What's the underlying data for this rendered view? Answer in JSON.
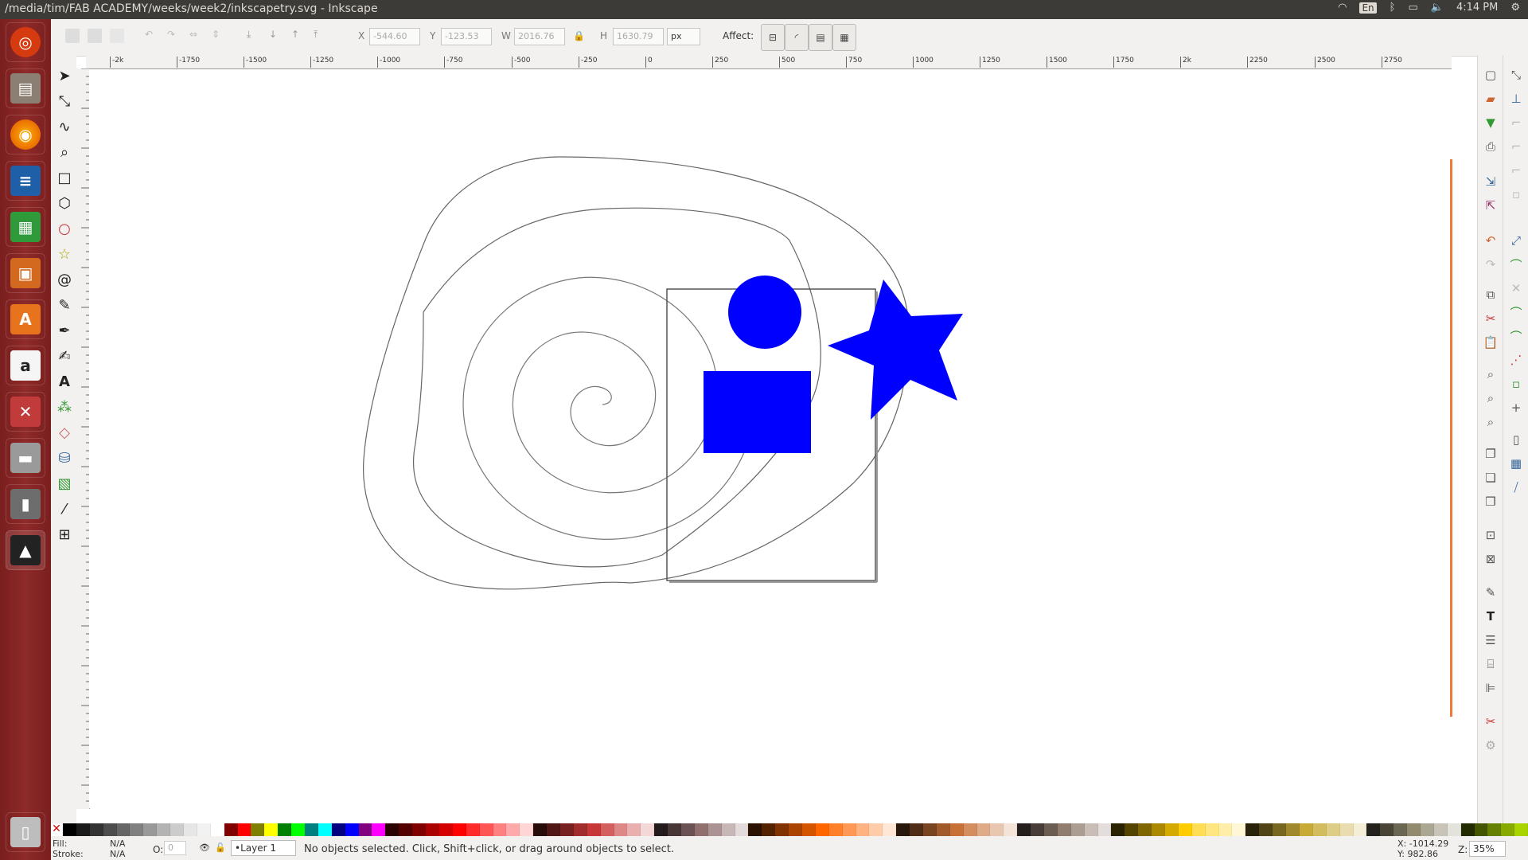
{
  "window": {
    "title": "/media/tim/FAB ACADEMY/weeks/week2/inkscapetry.svg - Inkscape"
  },
  "tray": {
    "lang": "En",
    "time": "4:14 PM"
  },
  "toolbar": {
    "x_label": "X",
    "x_value": "-544.60",
    "y_label": "Y",
    "y_value": "-123.53",
    "w_label": "W",
    "w_value": "2016.76",
    "h_label": "H",
    "h_value": "1630.79",
    "unit": "px",
    "affect_label": "Affect:"
  },
  "ruler": {
    "ticks": [
      "-2k",
      "-1750",
      "-1500",
      "-1250",
      "-1000",
      "-750",
      "-500",
      "-250",
      "0",
      "250",
      "500",
      "750",
      "1000",
      "1250",
      "1500",
      "1750",
      "2k",
      "2250",
      "2500",
      "2750"
    ]
  },
  "status": {
    "fill_label": "Fill:",
    "fill_value": "N/A",
    "stroke_label": "Stroke:",
    "stroke_value": "N/A",
    "opacity_label": "O:",
    "opacity_value": "0",
    "layer": "•Layer 1",
    "message": "No objects selected. Click, Shift+click, or drag around objects to select.",
    "cursor_x": "X: -1014.29",
    "cursor_y": "Y:   982.86",
    "zoom_label": "Z:",
    "zoom_value": "35%"
  },
  "palette": [
    "#000000",
    "#1a1a1a",
    "#333333",
    "#4d4d4d",
    "#666666",
    "#808080",
    "#999999",
    "#b3b3b3",
    "#cccccc",
    "#e6e6e6",
    "#f2f2f2",
    "#ffffff",
    "#800000",
    "#ff0000",
    "#808000",
    "#ffff00",
    "#008000",
    "#00ff00",
    "#008080",
    "#00ffff",
    "#000080",
    "#0000ff",
    "#800080",
    "#ff00ff",
    "#2b0000",
    "#550000",
    "#800000",
    "#aa0000",
    "#d40000",
    "#ff0000",
    "#ff2a2a",
    "#ff5555",
    "#ff8080",
    "#ffaaaa",
    "#ffd5d5",
    "#280b0b",
    "#501616",
    "#782121",
    "#a02c2c",
    "#c83737",
    "#d35f5f",
    "#de8787",
    "#e9afaf",
    "#f4d7d7",
    "#241c1c",
    "#483737",
    "#6c5353",
    "#916f6f",
    "#ac9393",
    "#c8b7b7",
    "#e3dbdb",
    "#2b1100",
    "#552200",
    "#803300",
    "#aa4400",
    "#d45500",
    "#ff6600",
    "#ff7f2a",
    "#ff9955",
    "#ffb380",
    "#ffccaa",
    "#ffe6d5",
    "#28170b",
    "#502d16",
    "#784421",
    "#a05a2c",
    "#c87137",
    "#d38d5f",
    "#deaa87",
    "#e9c6af",
    "#f4e3d7",
    "#241f1c",
    "#483e37",
    "#6c5d53",
    "#917c6f",
    "#ac9d93",
    "#c8beb7",
    "#e3dedb",
    "#2b2200",
    "#554400",
    "#806600",
    "#aa8800",
    "#d4aa00",
    "#ffcc00",
    "#ffdd55",
    "#ffe680",
    "#ffeeaa",
    "#fff6d5",
    "#28220b",
    "#504416",
    "#786721",
    "#a0892c",
    "#c8ab37",
    "#d3bc5f",
    "#decd87",
    "#e9ddaf",
    "#f4eed7",
    "#24221c",
    "#484537",
    "#6c6753",
    "#918a6f",
    "#aca793",
    "#c8c4b7",
    "#e3e2db",
    "#222b00",
    "#445500",
    "#668000",
    "#88aa00",
    "#aad400"
  ]
}
